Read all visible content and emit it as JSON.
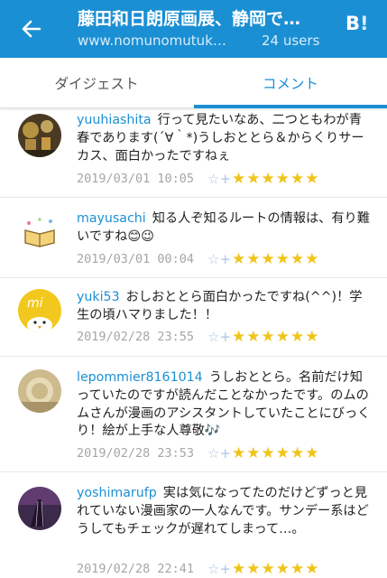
{
  "header": {
    "title": "藤田和日朗原画展、静岡で…",
    "url": "www.nomunomutuk…",
    "users": "24 users",
    "b_logo": "B",
    "b_logo_bang": "!",
    "icons": {
      "back": "arrow-left-icon",
      "hatena": "hatena-bookmark-icon"
    },
    "colors": {
      "bar": "#1b8fd3",
      "link": "#1b8fd3",
      "star": "#f0c419"
    }
  },
  "tabs": [
    {
      "label": "ダイジェスト",
      "active": false
    },
    {
      "label": "コメント",
      "active": true
    }
  ],
  "comments": [
    {
      "user": "yuuhiashita",
      "text": "行って見たいなあ、二つともわが青春であります(´∀｀*)うしおととら＆からくりサーカス、面白かったですねぇ",
      "date": "2019/03/01 10:05",
      "add_star": "☆+",
      "stars": "★★★★★★"
    },
    {
      "user": "mayusachi",
      "text": "知る人ぞ知るルートの情報は、有り難いですね😊😉",
      "date": "2019/03/01 00:04",
      "add_star": "☆+",
      "stars": "★★★★★★"
    },
    {
      "user": "yuki53",
      "text": "おしおととら面白かったですね(^^)！学生の頃ハマりました！！",
      "date": "2019/02/28 23:55",
      "add_star": "☆+",
      "stars": "★★★★★★"
    },
    {
      "user": "lepommier8161014",
      "text": "うしおととら。名前だけ知っていたのですが読んだことなかったです。のムのムさんが漫画のアシスタントしていたことにびっくり！絵が上手な人尊敬🎶",
      "date": "2019/02/28 23:53",
      "add_star": "☆+",
      "stars": "★★★★★★"
    },
    {
      "user": "yoshimarufp",
      "text": "実は気になってたのだけどずっと見れていない漫画家の一人なんです。サンデー系はどうしてもチェックが遅れてしまって…。",
      "date": "2019/02/28 22:41",
      "add_star": "☆+",
      "stars": "★★★★★★"
    }
  ]
}
